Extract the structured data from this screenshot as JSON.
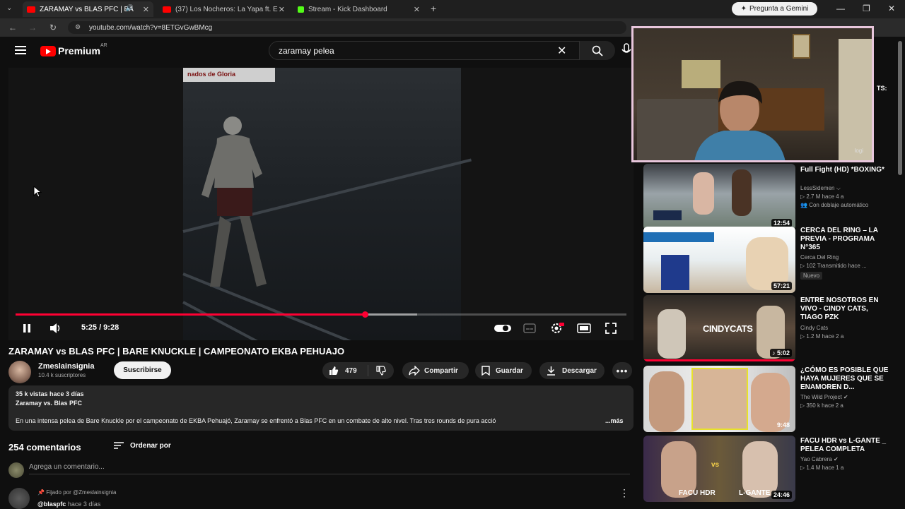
{
  "browser": {
    "tabs": [
      {
        "title": "ZARAMAY vs BLAS PFC | BA",
        "color": "#ff0000"
      },
      {
        "title": "(37) Los Nocheros: La Yapa ft. E",
        "color": "#ff0000"
      },
      {
        "title": "Stream - Kick Dashboard",
        "color": "#53fc18"
      }
    ],
    "gemini_label": "Pregunta a Gemini",
    "url": "youtube.com/watch?v=8ETGvGwBMcg"
  },
  "header": {
    "brand": "Premium",
    "country_code": "AR",
    "search_value": "zaramay pelea"
  },
  "video": {
    "banner_text": "nados de Gloria",
    "time": "5:25 / 9:28",
    "progress": 0.5723,
    "buffered": 0.657,
    "title": "ZARAMAY vs BLAS PFC | BARE KNUCKLE | CAMPEONATO EKBA PEHUAJO"
  },
  "channel": {
    "name": "Zmeslainsignia",
    "subscribers": "10.4 k suscriptores",
    "subscribe_label": "Suscribirse"
  },
  "actions": {
    "likes": "479",
    "share": "Compartir",
    "save": "Guardar",
    "download": "Descargar"
  },
  "description": {
    "stats": "35 k vistas  hace 3 días",
    "subtitle": "Zaramay vs. Blas PFC",
    "text": "En una intensa pelea de Bare Knuckle por el campeonato de EKBA Pehuajó, Zaramay se enfrentó a Blas PFC en un combate de alto nivel. Tras tres rounds de pura acció",
    "more": "...más"
  },
  "comments": {
    "count_label": "254 comentarios",
    "sort_label": "Ordenar por",
    "input_placeholder": "Agrega un comentario...",
    "pinned_label": "Fijado por @Zmeslainsignia",
    "pinned_author": "@blaspfc",
    "pinned_time": "hace 3 días"
  },
  "webcam": {
    "label": "logi"
  },
  "sidebar": {
    "partial_text": "TS:",
    "recommendations": [
      {
        "title": "Full Fight (HD) *BOXING*",
        "channel": "LessSidemen",
        "meta": "▷ 2.7 M   hace 4 a",
        "badge": "Con doblaje automático",
        "duration": "12:54"
      },
      {
        "title": "CERCA DEL RING – LA PREVIA - PROGRAMA N°365",
        "channel": "Cerca Del Ring",
        "meta": "▷ 102  Transmitido hace ...",
        "badge": "Nuevo",
        "duration": "57:21"
      },
      {
        "title": "ENTRE NOSOTROS EN VIVO - CINDY CATS, TIAGO PZK",
        "channel": "Cindy Cats",
        "meta": "▷ 1.2 M   hace 2 a",
        "badge": "",
        "duration": "5:02",
        "thumb_text": "CINDYCATS"
      },
      {
        "title": "¿CÓMO ES POSIBLE QUE HAYA MUJERES QUE SE ENAMOREN D...",
        "channel": "The Wild Project",
        "meta": "▷ 350 k   hace 2 a",
        "badge": "",
        "duration": "9:48"
      },
      {
        "title": "FACU HDR vs L-GANTE _ PELEA COMPLETA",
        "channel": "Yao Cabrera",
        "meta": "▷ 1.4 M   hace 1 a",
        "badge": "",
        "duration": "24:46",
        "thumb_left": "FACU HDR",
        "thumb_right": "L-GANTE",
        "thumb_vs": "vs"
      }
    ]
  },
  "colors": {
    "accent": "#ff0033",
    "background": "#0f0f0f",
    "pill": "#272727"
  }
}
